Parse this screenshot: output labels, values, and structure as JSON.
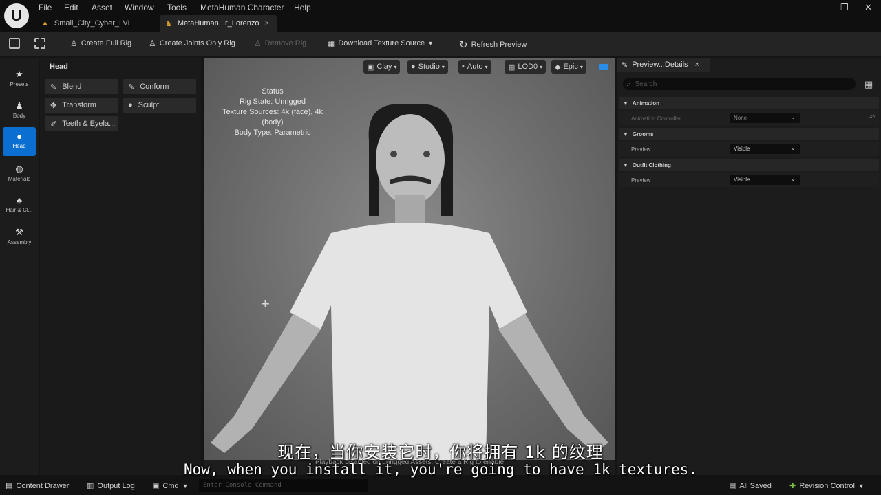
{
  "menu": [
    "File",
    "Edit",
    "Asset",
    "Window",
    "Tools",
    "MetaHuman Character",
    "Help"
  ],
  "tabs": [
    {
      "label": "Small_City_Cyber_LVL"
    },
    {
      "label": "MetaHuman...r_Lorenzo"
    }
  ],
  "toolbar": {
    "create_full_rig": "Create Full Rig",
    "create_joints": "Create Joints Only Rig",
    "remove_rig": "Remove Rig",
    "download_texture": "Download Texture Source",
    "refresh_preview": "Refresh Preview"
  },
  "rail": [
    {
      "label": "Presets",
      "icon": "star-icon"
    },
    {
      "label": "Body",
      "icon": "body-icon"
    },
    {
      "label": "Head",
      "icon": "head-icon"
    },
    {
      "label": "Materials",
      "icon": "materials-icon"
    },
    {
      "label": "Hair & Cl...",
      "icon": "hair-icon"
    },
    {
      "label": "Assembly",
      "icon": "hammer-icon"
    }
  ],
  "tools": {
    "title": "Head",
    "items": [
      "Blend",
      "Conform",
      "Transform",
      "Sculpt",
      "Teeth & Eyela..."
    ]
  },
  "viewport": {
    "buttons": [
      "Clay",
      "Studio",
      "Auto",
      "LOD0",
      "Epic"
    ],
    "status": {
      "title": "Status",
      "rig_state": "Rig State: Unrigged",
      "texture_sources": "Texture Sources: 4k (face), 4k (body)",
      "body_type": "Body Type: Parametric"
    },
    "playback": "Playback disabled on unrigged Assets. Create a Rig to enable"
  },
  "details": {
    "tab": "Preview...Details",
    "search_placeholder": "Search",
    "sections": [
      {
        "title": "Animation",
        "rows": [
          {
            "label": "Animation Controller",
            "value": "None"
          }
        ]
      },
      {
        "title": "Grooms",
        "rows": [
          {
            "label": "Preview",
            "value": "Visible"
          }
        ]
      },
      {
        "title": "Outfit Clothing",
        "rows": [
          {
            "label": "Preview",
            "value": "Visible"
          }
        ]
      }
    ]
  },
  "bottom": {
    "content_drawer": "Content Drawer",
    "output_log": "Output Log",
    "cmd": "Cmd",
    "console_placeholder": "Enter Console Command",
    "all_saved": "All Saved",
    "revision_control": "Revision Control"
  },
  "subtitles": {
    "cn": "现在，当你安装它时，你将拥有 1k 的纹理",
    "en": "Now, when you install it, you're going to have 1k textures."
  }
}
